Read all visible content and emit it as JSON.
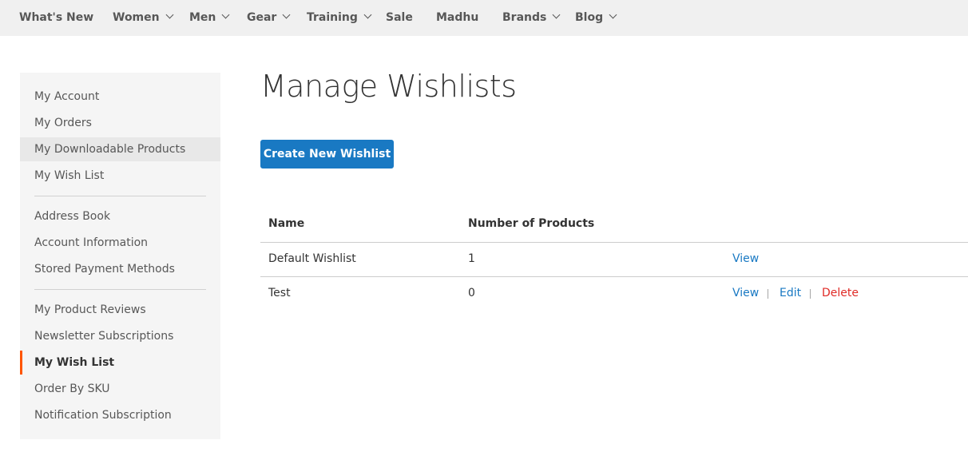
{
  "topnav": {
    "items": [
      {
        "label": "What's New",
        "has_dropdown": false
      },
      {
        "label": "Women",
        "has_dropdown": true
      },
      {
        "label": "Men",
        "has_dropdown": true
      },
      {
        "label": "Gear",
        "has_dropdown": true
      },
      {
        "label": "Training",
        "has_dropdown": true
      },
      {
        "label": "Sale",
        "has_dropdown": false
      },
      {
        "label": "Madhu",
        "has_dropdown": false
      },
      {
        "label": "Brands",
        "has_dropdown": true
      },
      {
        "label": "Blog",
        "has_dropdown": true
      }
    ]
  },
  "sidebar": {
    "items": [
      {
        "label": "My Account"
      },
      {
        "label": "My Orders"
      },
      {
        "label": "My Downloadable Products",
        "state": "hover"
      },
      {
        "label": "My Wish List"
      },
      {
        "label": "Address Book"
      },
      {
        "label": "Account Information"
      },
      {
        "label": "Stored Payment Methods"
      },
      {
        "label": "My Product Reviews"
      },
      {
        "label": "Newsletter Subscriptions"
      },
      {
        "label": "My Wish List",
        "state": "active"
      },
      {
        "label": "Order By SKU"
      },
      {
        "label": "Notification Subscription"
      }
    ],
    "active_indicator_color": "#ff5501"
  },
  "main": {
    "title": "Manage Wishlists",
    "create_button_label": "Create New Wishlist",
    "table": {
      "headers": {
        "name": "Name",
        "count": "Number of Products"
      },
      "rows": [
        {
          "name": "Default Wishlist",
          "count": "1",
          "actions": {
            "view": "View"
          }
        },
        {
          "name": "Test",
          "count": "0",
          "actions": {
            "view": "View",
            "edit": "Edit",
            "delete": "Delete"
          }
        }
      ]
    }
  },
  "colors": {
    "link": "#1979c3",
    "danger": "#e02b27",
    "button": "#1979c3",
    "nav_bg": "#f0f0f0",
    "sidebar_bg": "#f5f5f5"
  }
}
